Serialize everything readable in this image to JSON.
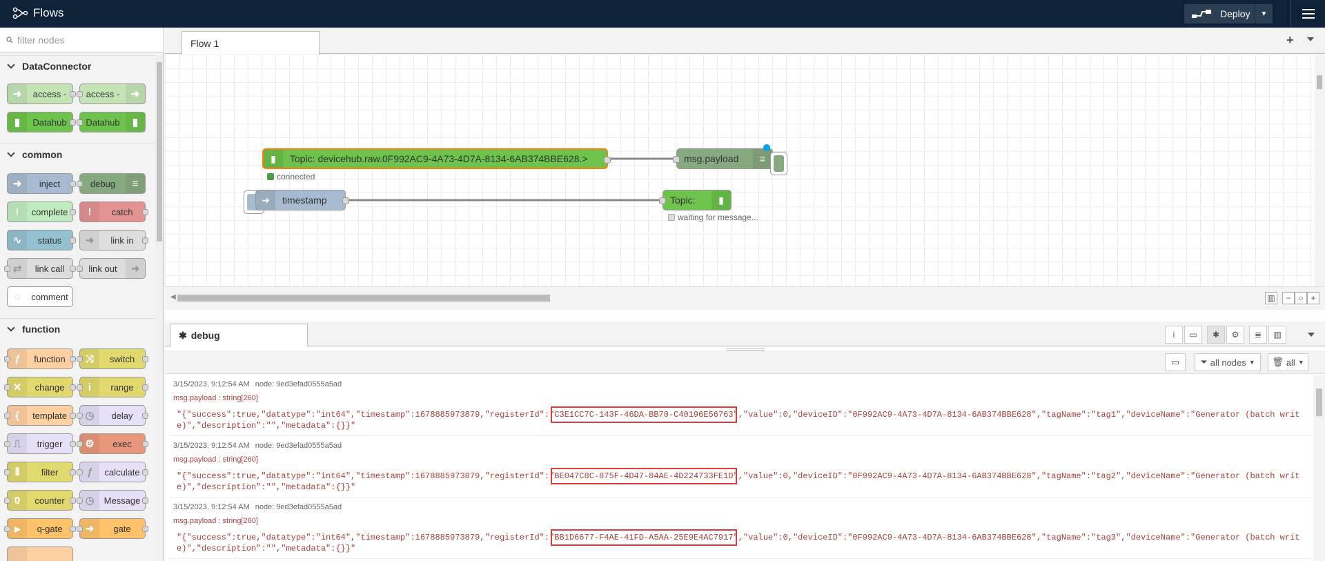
{
  "header": {
    "title": "Flows",
    "deploy_label": "Deploy"
  },
  "palette": {
    "filter_placeholder": "filter nodes",
    "categories": [
      {
        "name": "DataConnector",
        "nodes": [
          "access -",
          "access -",
          "Datahub",
          "Datahub"
        ]
      },
      {
        "name": "common",
        "nodes": [
          "inject",
          "debug",
          "complete",
          "catch",
          "status",
          "link in",
          "link call",
          "link out",
          "comment"
        ]
      },
      {
        "name": "function",
        "nodes": [
          "function",
          "switch",
          "change",
          "range",
          "template",
          "delay",
          "trigger",
          "exec",
          "filter",
          "calculate",
          "counter",
          "Message",
          "q-gate",
          "gate"
        ]
      }
    ]
  },
  "workspace": {
    "tab": "Flow 1",
    "nodes": {
      "topic_in": "Topic: devicehub.raw.0F992AC9-4A73-4D7A-8134-6AB374BBE628.>",
      "topic_in_status": "connected",
      "msg_payload": "msg.payload",
      "timestamp": "timestamp",
      "topic_out": "Topic:",
      "topic_out_status": "waiting for message..."
    }
  },
  "debug": {
    "tab_label": "debug",
    "filter_label": "all nodes",
    "clear_label": "all",
    "messages": [
      {
        "time": "3/15/2023, 9:12:54 AM",
        "node": "node: 9ed3efad0555a5ad",
        "type": "msg.payload : string[260]",
        "pre": "\"{\"success\":true,\"datatype\":\"int64\",\"timestamp\":1678885973879,\"registerId\":\"",
        "register": "C3E1CC7C-143F-46DA-BB70-C40196E56763",
        "post": "\",\"value\":0,\"deviceID\":\"0F992AC9-4A73-4D7A-8134-6AB374BBE628\",\"tagName\":\"tag1\",\"deviceName\":\"Generator (batch write)\",\"description\":\"\",\"metadata\":{}}\""
      },
      {
        "time": "3/15/2023, 9:12:54 AM",
        "node": "node: 9ed3efad0555a5ad",
        "type": "msg.payload : string[260]",
        "pre": "\"{\"success\":true,\"datatype\":\"int64\",\"timestamp\":1678885973879,\"registerId\":\"",
        "register": "BE047C8C-875F-4D47-84AE-4D224733FE1D",
        "post": "\",\"value\":0,\"deviceID\":\"0F992AC9-4A73-4D7A-8134-6AB374BBE628\",\"tagName\":\"tag2\",\"deviceName\":\"Generator (batch write)\",\"description\":\"\",\"metadata\":{}}\""
      },
      {
        "time": "3/15/2023, 9:12:54 AM",
        "node": "node: 9ed3efad0555a5ad",
        "type": "msg.payload : string[260]",
        "pre": "\"{\"success\":true,\"datatype\":\"int64\",\"timestamp\":1678885973879,\"registerId\":\"",
        "register": "BB1D6677-F4AE-41FD-A5AA-25E9E4AC7917",
        "post": "\",\"value\":0,\"deviceID\":\"0F992AC9-4A73-4D7A-8134-6AB374BBE628\",\"tagName\":\"tag3\",\"deviceName\":\"Generator (batch write)\",\"description\":\"\",\"metadata\":{}}\""
      }
    ]
  },
  "colors": {
    "header_bg": "#0d2137",
    "datahub_green": "#6dc34b",
    "common_blue": "#a6bbcf",
    "debug_green": "#87a980",
    "function_orange": "#fdd0a2",
    "switch_yellow": "#e2d96e",
    "payload_red": "#a8413b",
    "highlight_red": "#e03a3a"
  }
}
